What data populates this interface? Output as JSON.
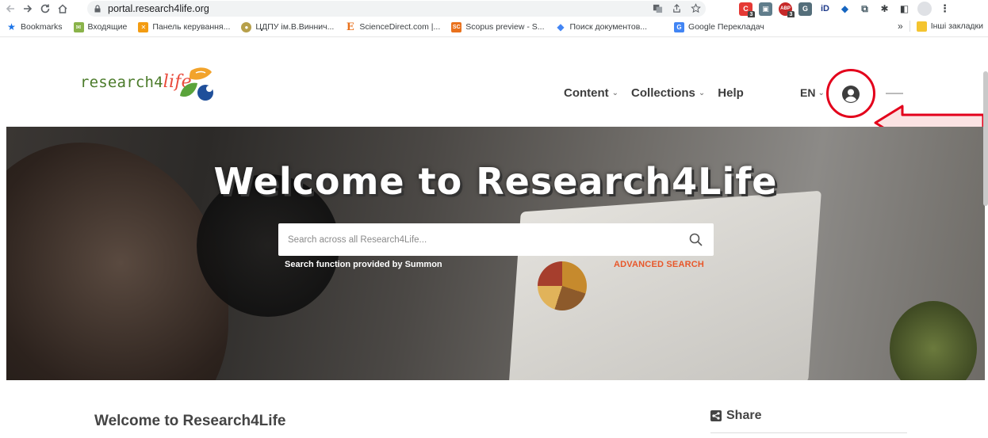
{
  "browser": {
    "url": "portal.research4life.org",
    "bookmarks": [
      {
        "label": "Bookmarks",
        "icon": "star-icon",
        "color": "#1a73e8"
      },
      {
        "label": "Входящие",
        "icon": "mail-icon",
        "color": "#8ab34a"
      },
      {
        "label": "Панель керування...",
        "icon": "joomla-icon",
        "color": "#f39c12"
      },
      {
        "label": "ЦДПУ ім.В.Виннич...",
        "icon": "university-icon",
        "color": "#b7a04a"
      },
      {
        "label": "ScienceDirect.com |...",
        "icon": "elsevier-icon",
        "color": "#e9711c"
      },
      {
        "label": "Scopus preview - S...",
        "icon": "scopus-icon",
        "color": "#e9711c"
      },
      {
        "label": "Поиск документов...",
        "icon": "google-docs-search-icon",
        "color": "#4285f4"
      },
      {
        "label": "Google Перекладач",
        "icon": "translate-icon",
        "color": "#4285f4"
      }
    ],
    "bookmarks_more": "»",
    "other_bookmarks": "Інші закладки",
    "extension_badges": [
      "3",
      "ABP",
      "3"
    ]
  },
  "site": {
    "logo": {
      "prefix": "research4",
      "suffix": "life"
    },
    "nav": [
      {
        "label": "Content"
      },
      {
        "label": "Collections"
      },
      {
        "label": "Help"
      }
    ],
    "language": "EN"
  },
  "hero": {
    "title": "Welcome to Research4Life",
    "search_placeholder": "Search across all Research4Life...",
    "search_note": "Search function provided by Summon",
    "advanced_search": "ADVANCED SEARCH"
  },
  "content": {
    "heading": "Welcome to Research4Life",
    "share_label": "Share"
  },
  "colors": {
    "annotation_red": "#e3001b",
    "accent_orange": "#e8572a",
    "logo_green": "#4b7b2a",
    "logo_red": "#e94b3c"
  }
}
